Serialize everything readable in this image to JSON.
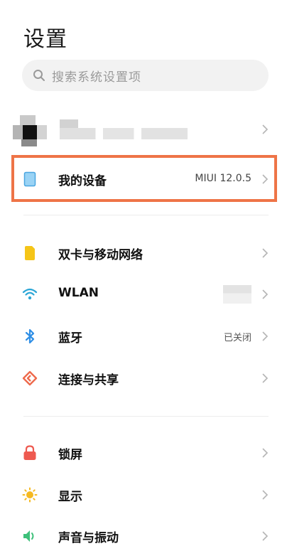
{
  "page_title": "设置",
  "search": {
    "placeholder": "搜索系统设置项"
  },
  "my_device": {
    "label": "我的设备",
    "value": "MIUI 12.0.5"
  },
  "network_items": [
    {
      "label": "双卡与移动网络",
      "icon": "sim-card-icon",
      "color": "#f5c518"
    },
    {
      "label": "WLAN",
      "icon": "wifi-icon",
      "color": "#2ba6d6"
    },
    {
      "label": "蓝牙",
      "icon": "bluetooth-icon",
      "color": "#2f8fe6",
      "value": "已关闭"
    },
    {
      "label": "连接与共享",
      "icon": "share-connection-icon",
      "color": "#ee6a4c"
    }
  ],
  "display_items": [
    {
      "label": "锁屏",
      "icon": "lock-icon",
      "color": "#ee5a50"
    },
    {
      "label": "显示",
      "icon": "sun-icon",
      "color": "#f5b921"
    },
    {
      "label": "声音与振动",
      "icon": "speaker-icon",
      "color": "#3ec07a"
    }
  ],
  "colors": {
    "highlight_border": "#ee7447",
    "search_bg": "#f2f2f2"
  }
}
